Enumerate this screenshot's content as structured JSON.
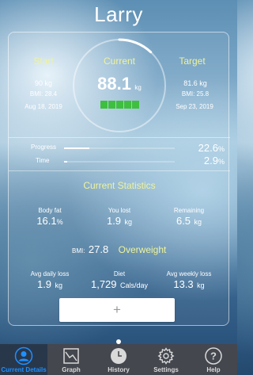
{
  "header": {
    "title": "Larry"
  },
  "summary": {
    "start": {
      "label": "Start",
      "weight": "90 kg",
      "bmi": "BMI: 28.4",
      "date": "Aug 18, 2019"
    },
    "current": {
      "label": "Current",
      "weight": "88.1",
      "unit": "kg",
      "segments_filled": 5,
      "segments_total": 5,
      "segment_color": "#3fbf3f"
    },
    "target": {
      "label": "Target",
      "weight": "81.6 kg",
      "bmi": "BMI: 25.8",
      "date": "Sep 23, 2019"
    },
    "ring_progress_fraction": 0.12
  },
  "progress": {
    "progress_label": "Progress",
    "progress_value": "22.6",
    "progress_unit": "%",
    "progress_fraction": 0.226,
    "time_label": "Time",
    "time_value": "2.9",
    "time_unit": "%",
    "time_fraction": 0.029
  },
  "stats": {
    "heading": "Current Statistics",
    "body_fat_label": "Body fat",
    "body_fat_value": "16.1",
    "body_fat_unit": "%",
    "lost_label": "You lost",
    "lost_value": "1.9",
    "lost_unit": "kg",
    "remaining_label": "Remaining",
    "remaining_value": "6.5",
    "remaining_unit": "kg",
    "bmi_label": "BMI:",
    "bmi_value": "27.8",
    "bmi_category": "Overweight",
    "avg_daily_label": "Avg daily loss",
    "avg_daily_value": "1.9",
    "avg_daily_unit": "kg",
    "diet_label": "Diet",
    "diet_value": "1,729",
    "diet_unit": "Cals/day",
    "avg_weekly_label": "Avg weekly loss",
    "avg_weekly_value": "13.3",
    "avg_weekly_unit": "kg"
  },
  "add_button": {
    "label": "+"
  },
  "tabs": [
    {
      "label": "Current Details",
      "icon": "person-icon",
      "active": true
    },
    {
      "label": "Graph",
      "icon": "graph-icon",
      "active": false
    },
    {
      "label": "History",
      "icon": "clock-icon",
      "active": false
    },
    {
      "label": "Settings",
      "icon": "gear-icon",
      "active": false
    },
    {
      "label": "Help",
      "icon": "help-icon",
      "active": false
    }
  ],
  "colors": {
    "accent_yellow": "#eef39a",
    "tab_active": "#1e90ff",
    "segment_green": "#3fbf3f"
  }
}
